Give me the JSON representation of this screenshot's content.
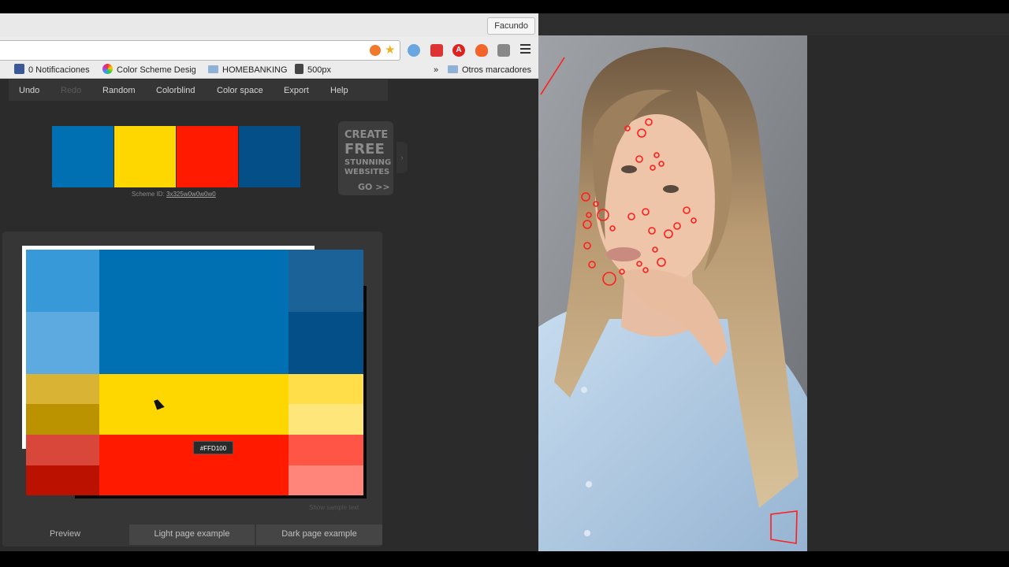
{
  "browser": {
    "profile_name": "Facundo",
    "bookmarks": [
      {
        "label": "0 Notificaciones",
        "icon": "facebook-icon"
      },
      {
        "label": "Color Scheme Desig",
        "icon": "color-wheel-icon"
      },
      {
        "label": "HOMEBANKING",
        "icon": "folder-icon"
      },
      {
        "label": "500px",
        "icon": "500px-icon"
      }
    ],
    "overflow_label": "»",
    "other_bookmarks": "Otros marcadores"
  },
  "app": {
    "menu": [
      {
        "label": "Undo",
        "enabled": true
      },
      {
        "label": "Redo",
        "enabled": false
      },
      {
        "label": "Random",
        "enabled": true
      },
      {
        "label": "Colorblind",
        "enabled": true
      },
      {
        "label": "Color space",
        "enabled": true
      },
      {
        "label": "Export",
        "enabled": true
      },
      {
        "label": "Help",
        "enabled": true
      }
    ],
    "scheme_colors": [
      "#0070B3",
      "#FFD700",
      "#FF1A00",
      "#044F87"
    ],
    "scheme_id_label": "Scheme ID:",
    "scheme_id": "3x325w0w0w0w0",
    "ad": {
      "line1": "CREATE",
      "line2": "FREE",
      "line3": "STUNNING",
      "line4": "WEBSITES",
      "cta": "GO >>"
    },
    "preview_tooltip": "#FFD100",
    "show_sample_text": "Show sample text",
    "tabs": [
      "Preview",
      "Light page example",
      "Dark page example"
    ],
    "grid_colors": {
      "blue": [
        "#3799D8",
        "#5DAAE0",
        "#0070B3",
        "#1B6299",
        "#044F87"
      ],
      "yellow": [
        "#D9B334",
        "#BB9200",
        "#FFD700",
        "#FFDE4A",
        "#FFE67B"
      ],
      "red": [
        "#D9463A",
        "#BB1100",
        "#FF1A00",
        "#FF5546",
        "#FF857A"
      ]
    }
  },
  "photo": {
    "subject": "portrait-with-blemish-markings"
  }
}
